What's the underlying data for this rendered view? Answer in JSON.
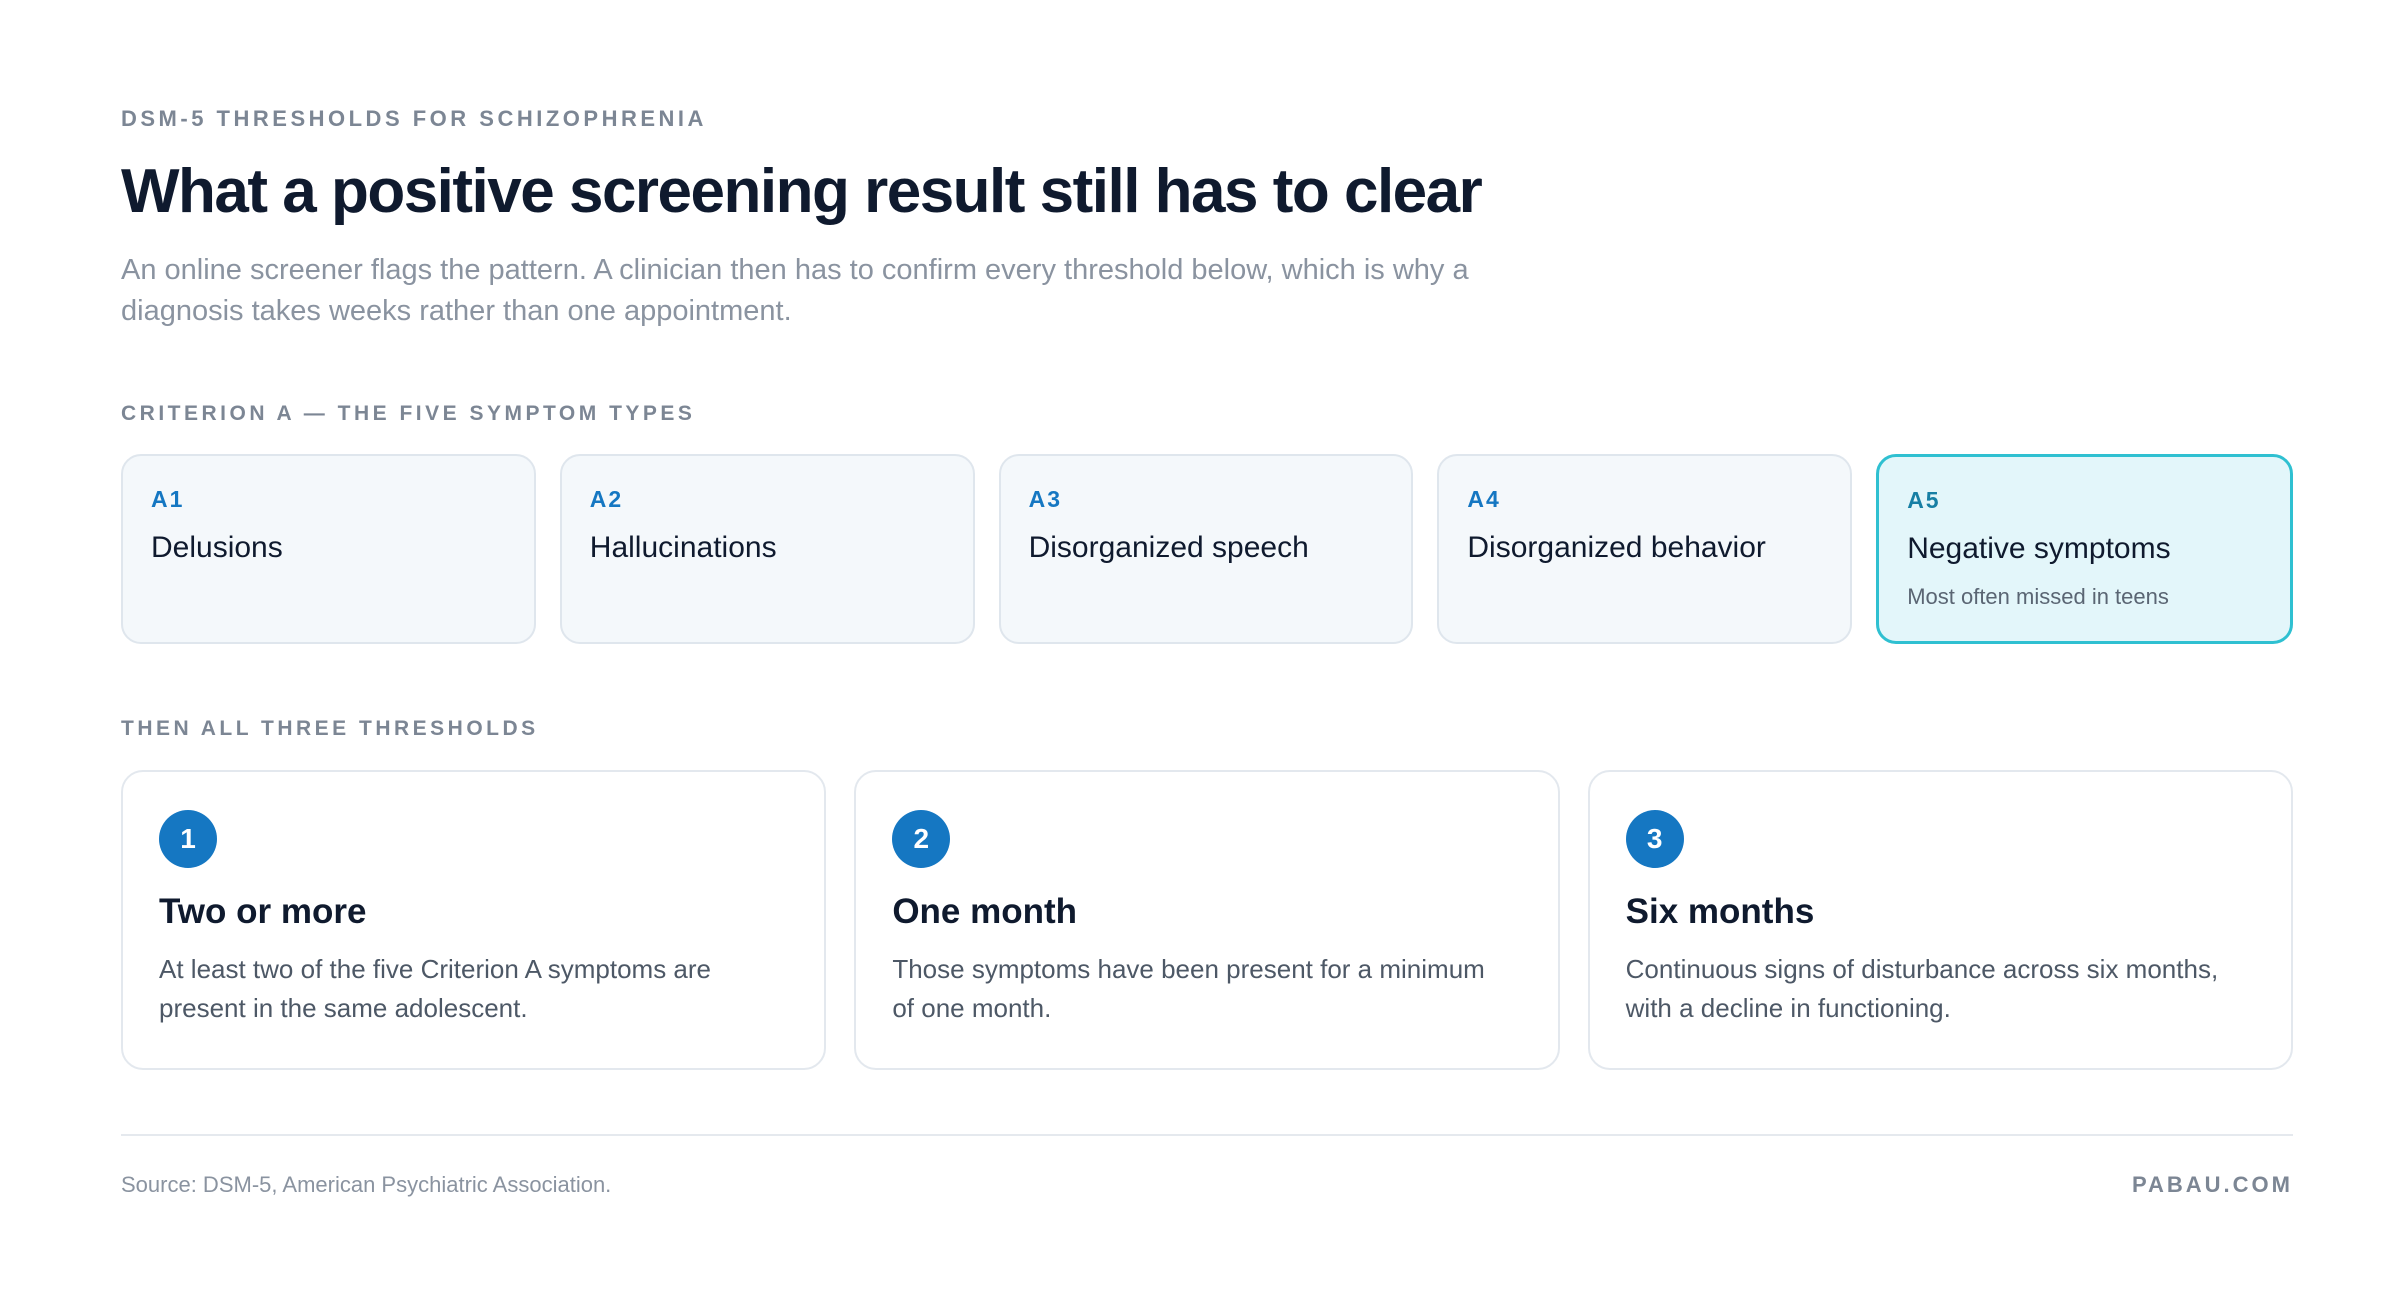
{
  "header": {
    "eyebrow": "DSM-5 THRESHOLDS FOR SCHIZOPHRENIA",
    "title": "What a positive screening result still has to clear",
    "subtitle": "An online screener flags the pattern. A clinician then has to confirm every threshold below, which is why a diagnosis takes weeks rather than one appointment."
  },
  "criterion_a": {
    "label": "CRITERION A — THE FIVE SYMPTOM TYPES",
    "items": [
      {
        "code": "A1",
        "name": "Delusions",
        "note": ""
      },
      {
        "code": "A2",
        "name": "Hallucinations",
        "note": ""
      },
      {
        "code": "A3",
        "name": "Disorganized speech",
        "note": ""
      },
      {
        "code": "A4",
        "name": "Disorganized behavior",
        "note": ""
      },
      {
        "code": "A5",
        "name": "Negative symptoms",
        "note": "Most often missed in teens"
      }
    ]
  },
  "thresholds": {
    "label": "THEN ALL THREE THRESHOLDS",
    "items": [
      {
        "number": "1",
        "heading": "Two or more",
        "body": "At least two of the five Criterion A symptoms are present in the same adolescent."
      },
      {
        "number": "2",
        "heading": "One month",
        "body": "Those symptoms have been present for a minimum of one month."
      },
      {
        "number": "3",
        "heading": "Six months",
        "body": "Continuous signs of disturbance across six months, with a decline in functioning."
      }
    ]
  },
  "footer": {
    "source": "Source: DSM-5, American Psychiatric Association.",
    "brand": "PABAU.COM"
  },
  "colors": {
    "accent": "#1577c2",
    "highlight_border": "#2fc0d1",
    "highlight_fill": "#e3f6fa",
    "title": "#0f1a2e"
  }
}
